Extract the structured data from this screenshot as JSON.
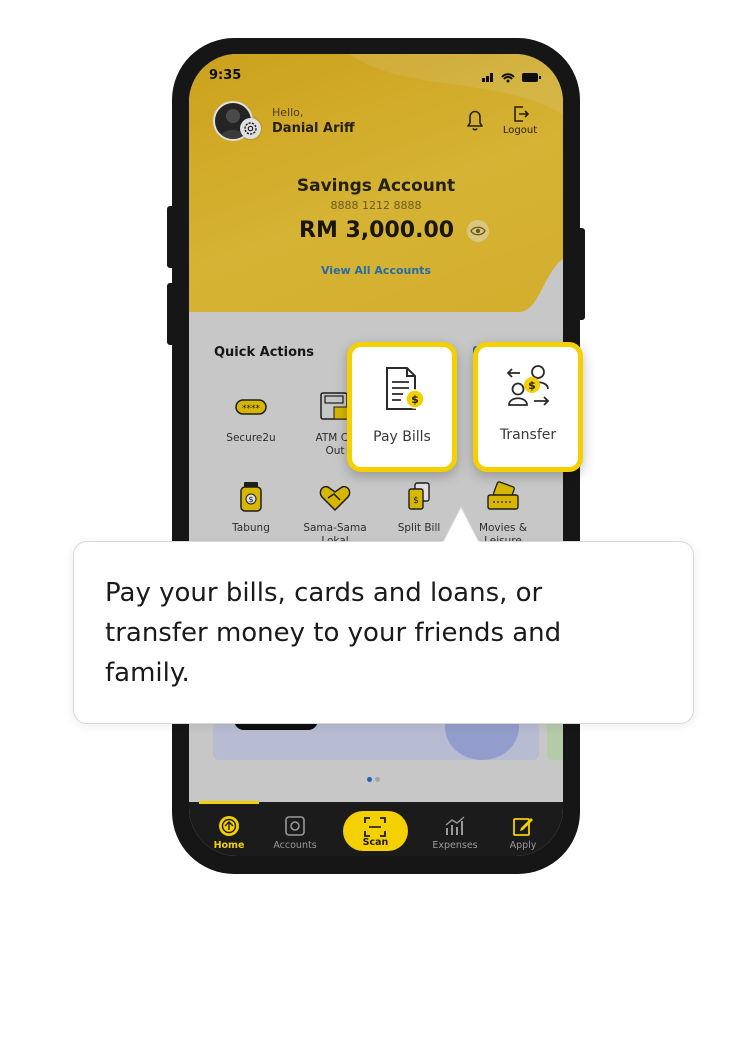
{
  "status": {
    "time": "9:35"
  },
  "user": {
    "greeting": "Hello,",
    "name": "Danial Ariff"
  },
  "header": {
    "logout_label": "Logout"
  },
  "account": {
    "title": "Savings Account",
    "number": "8888 1212 8888",
    "balance": "RM 3,000.00",
    "view_all": "View All Accounts"
  },
  "quick_actions": {
    "title": "Quick Actions",
    "items": [
      {
        "label": "Secure2u",
        "icon": "secure2u-icon"
      },
      {
        "label": "ATM Ca",
        "label2": "Out",
        "icon": "atm-icon"
      },
      {
        "label": "Pay Bills",
        "icon": "bill-icon"
      },
      {
        "label": "Transfer",
        "icon": "transfer-icon"
      },
      {
        "label": "Tabung",
        "icon": "jar-icon"
      },
      {
        "label": "Sama-Sama",
        "label2": "Lokal",
        "icon": "handshake-icon"
      },
      {
        "label": "Split Bill",
        "icon": "split-bill-icon"
      },
      {
        "label": "Movies &",
        "label2": "Leisure",
        "icon": "ticket-icon"
      }
    ]
  },
  "tooltip": {
    "text": "Pay your bills, cards and loans, or transfer money to your friends and family."
  },
  "nav": {
    "items": [
      {
        "label": "Home",
        "icon": "home-icon",
        "active": true
      },
      {
        "label": "Accounts",
        "icon": "safe-icon"
      },
      {
        "label": "Scan",
        "icon": "scan-icon"
      },
      {
        "label": "Expenses",
        "icon": "chart-icon"
      },
      {
        "label": "Apply",
        "icon": "edit-icon"
      }
    ]
  },
  "colors": {
    "accent": "#f5d000",
    "header_yellow": "#f2c734",
    "link_blue": "#2a7bbf",
    "nav_bg": "#1b1b1b"
  }
}
